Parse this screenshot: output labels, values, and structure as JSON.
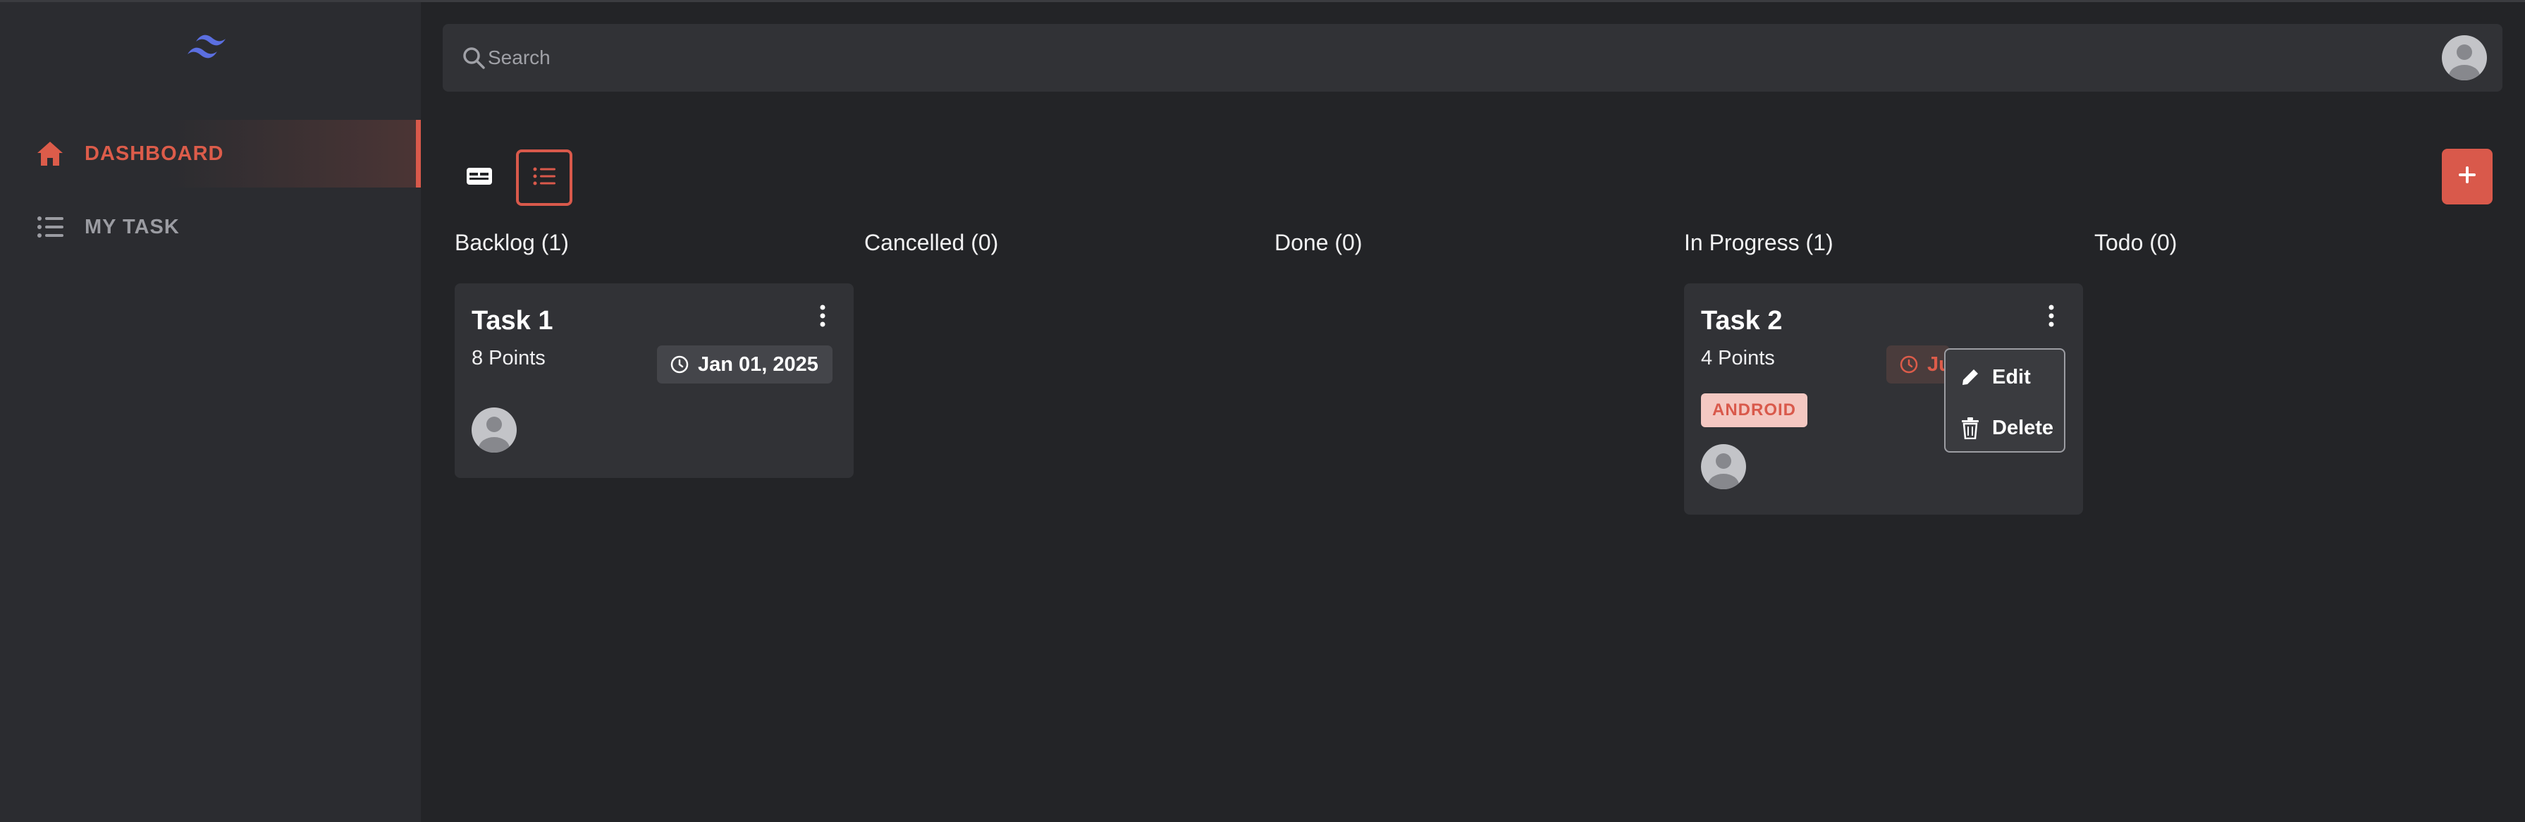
{
  "sidebar": {
    "items": [
      {
        "label": "DASHBOARD",
        "icon": "home-icon",
        "active": true
      },
      {
        "label": "MY TASK",
        "icon": "list-icon",
        "active": false
      }
    ]
  },
  "header": {
    "search": {
      "placeholder": "Search",
      "value": ""
    }
  },
  "toolbar": {
    "views": [
      {
        "icon": "board-view-icon"
      },
      {
        "icon": "list-view-icon",
        "selected": true
      }
    ],
    "add_label": "+"
  },
  "columns": [
    {
      "title": "Backlog (1)"
    },
    {
      "title": "Cancelled (0)"
    },
    {
      "title": "Done (0)"
    },
    {
      "title": "In Progress (1)"
    },
    {
      "title": "Todo (0)"
    }
  ],
  "cards": {
    "task1": {
      "title": "Task 1",
      "points": "8 Points",
      "date": "Jan 01, 2025"
    },
    "task2": {
      "title": "Task 2",
      "points": "4 Points",
      "date": "Ju",
      "tag": "ANDROID"
    }
  },
  "menu": {
    "edit_label": "Edit",
    "delete_label": "Delete"
  },
  "colors": {
    "accent": "#d9594b",
    "background": "#232427",
    "sidebar": "#2b2c30",
    "card": "#313236",
    "logo": "#5b6fe0"
  }
}
